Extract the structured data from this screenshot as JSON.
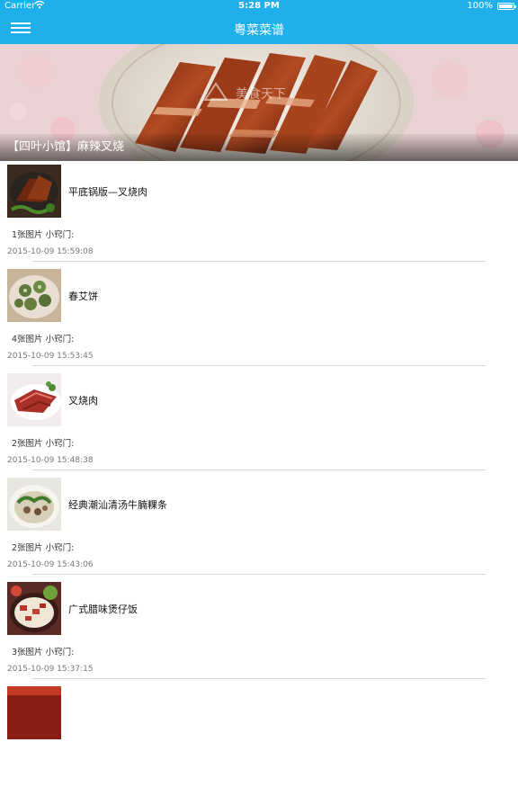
{
  "status_bar": {
    "carrier": "Carrier",
    "wifi_icon": "wifi-icon",
    "time": "5:28 PM",
    "battery_percent": "100%",
    "battery_icon": "battery-icon"
  },
  "nav_bar": {
    "title": "粤菜菜谱",
    "menu_icon": "hamburger-menu-icon",
    "background_color": "#1fb0ec"
  },
  "banner": {
    "caption": "【四叶小馆】麻辣叉烧",
    "watermark": "美食天下"
  },
  "recipes": [
    {
      "title": "平底锅版—叉烧肉",
      "meta": "1张图片 小窍门:",
      "date": "2015-10-09 15:59:08"
    },
    {
      "title": "春艾饼",
      "meta": "4张图片 小窍门:",
      "date": "2015-10-09 15:53:45"
    },
    {
      "title": "叉烧肉",
      "meta": "2张图片 小窍门:",
      "date": "2015-10-09 15:48:38"
    },
    {
      "title": "经典潮汕清汤牛腩粿条",
      "meta": "2张图片 小窍门:",
      "date": "2015-10-09 15:43:06"
    },
    {
      "title": "广式腊味煲仔饭",
      "meta": "3张图片 小窍门:",
      "date": "2015-10-09 15:37:15"
    }
  ]
}
